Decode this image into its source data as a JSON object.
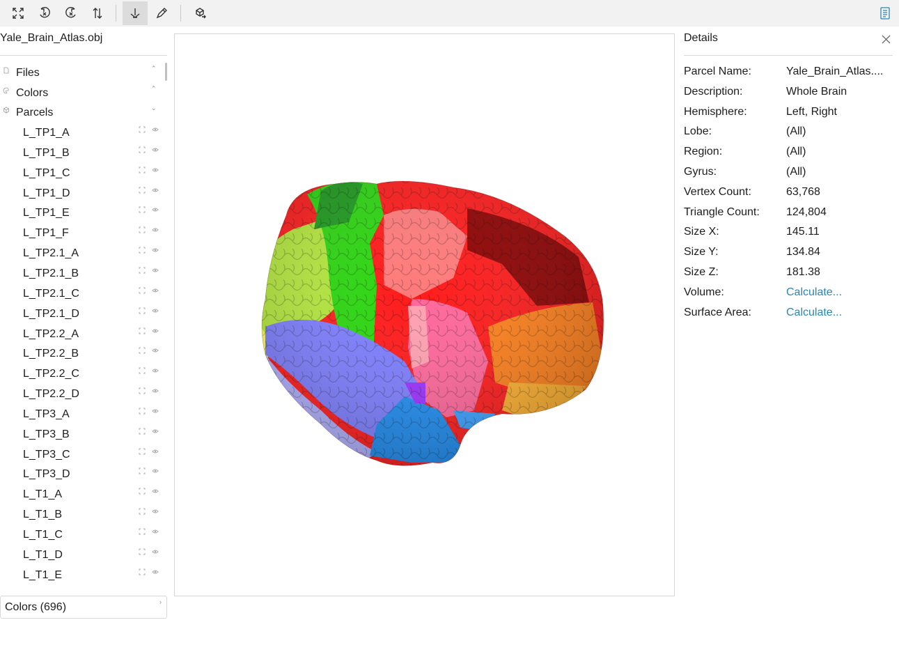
{
  "toolbar": {
    "buttons": [
      {
        "name": "fit-view-icon"
      },
      {
        "name": "rotate-left-icon"
      },
      {
        "name": "rotate-right-icon"
      },
      {
        "name": "flip-vertical-icon"
      },
      {
        "name": "pivot-tool-icon",
        "active": true
      },
      {
        "name": "draw-tool-icon"
      },
      {
        "name": "export-cube-icon"
      }
    ],
    "right_icon": "details-panel-icon"
  },
  "left_panel": {
    "title": "Yale_Brain_Atlas.obj",
    "sections": [
      {
        "label": "Files",
        "icon": "file-icon",
        "expanded": false
      },
      {
        "label": "Colors",
        "icon": "palette-icon",
        "expanded": false
      },
      {
        "label": "Parcels",
        "icon": "cube-icon",
        "expanded": true
      }
    ],
    "parcels": [
      "L_TP1_A",
      "L_TP1_B",
      "L_TP1_C",
      "L_TP1_D",
      "L_TP1_E",
      "L_TP1_F",
      "L_TP2.1_A",
      "L_TP2.1_B",
      "L_TP2.1_C",
      "L_TP2.1_D",
      "L_TP2.2_A",
      "L_TP2.2_B",
      "L_TP2.2_C",
      "L_TP2.2_D",
      "L_TP3_A",
      "L_TP3_B",
      "L_TP3_C",
      "L_TP3_D",
      "L_T1_A",
      "L_T1_B",
      "L_T1_C",
      "L_T1_D",
      "L_T1_E"
    ],
    "colors_dropdown": "Colors (696)"
  },
  "details": {
    "title": "Details",
    "rows": [
      {
        "key": "Parcel Name:",
        "value": "Yale_Brain_Atlas...."
      },
      {
        "key": "Description:",
        "value": "Whole Brain"
      },
      {
        "key": "Hemisphere:",
        "value": "Left, Right"
      },
      {
        "key": "Lobe:",
        "value": "(All)"
      },
      {
        "key": "Region:",
        "value": "(All)"
      },
      {
        "key": "Gyrus:",
        "value": "(All)"
      },
      {
        "key": "Vertex Count:",
        "value": "63,768"
      },
      {
        "key": "Triangle Count:",
        "value": "124,804"
      },
      {
        "key": "Size X:",
        "value": "145.11"
      },
      {
        "key": "Size Y:",
        "value": "134.84"
      },
      {
        "key": "Size Z:",
        "value": "181.38"
      },
      {
        "key": "Volume:",
        "value": "Calculate...",
        "link": true
      },
      {
        "key": "Surface Area:",
        "value": "Calculate...",
        "link": true
      }
    ]
  },
  "colors": {
    "link": "#2b86b3",
    "toolbar_bg": "#f2f2f2",
    "brain_regions": [
      "#ffff66",
      "#b4e83c",
      "#2bd60f",
      "#ff1a1a",
      "#8f0000",
      "#ff7a7a",
      "#ff6699",
      "#ff7f1a",
      "#ffb02e",
      "#7d7dff",
      "#b0b0ff",
      "#1e8cf0",
      "#9b30ff"
    ]
  }
}
